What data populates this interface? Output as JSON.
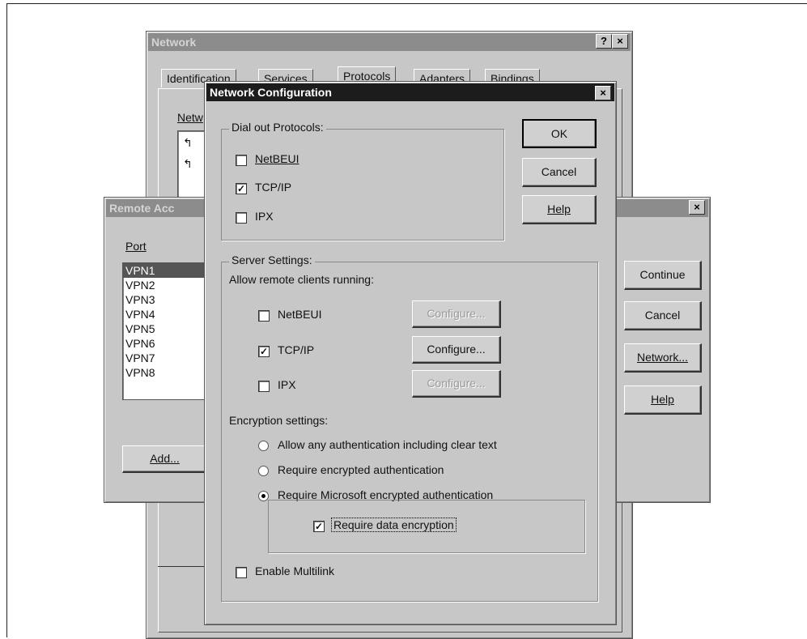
{
  "network_window": {
    "title": "Network",
    "help_btn": "?",
    "close_btn": "×",
    "tabs": [
      "Identification",
      "Services",
      "Protocols",
      "Adapters",
      "Bindings"
    ],
    "section_label": "Netw"
  },
  "remote_access_window": {
    "title": "Remote Acc",
    "close_btn": "×",
    "port_label": "Port",
    "ports": [
      "VPN1",
      "VPN2",
      "VPN3",
      "VPN4",
      "VPN5",
      "VPN6",
      "VPN7",
      "VPN8"
    ],
    "selected_port": "VPN1",
    "add_button": "Add...",
    "continue_button": "Continue",
    "cancel_button": "Cancel",
    "network_button": "Network...",
    "help_button": "Help"
  },
  "config_dialog": {
    "title": "Network Configuration",
    "close_btn": "×",
    "ok_button": "OK",
    "cancel_button": "Cancel",
    "help_button": "Help",
    "dial_out": {
      "label": "Dial out Protocols:",
      "netbeui": {
        "label": "NetBEUI",
        "checked": false
      },
      "tcpip": {
        "label": "TCP/IP",
        "checked": true
      },
      "ipx": {
        "label": "IPX",
        "checked": false
      }
    },
    "server": {
      "label": "Server Settings:",
      "allow_label": "Allow remote clients running:",
      "netbeui": {
        "label": "NetBEUI",
        "checked": false,
        "configure": "Configure..."
      },
      "tcpip": {
        "label": "TCP/IP",
        "checked": true,
        "configure": "Configure..."
      },
      "ipx": {
        "label": "IPX",
        "checked": false,
        "configure": "Configure..."
      },
      "encryption_label": "Encryption settings:",
      "enc_any": "Allow any authentication including clear text",
      "enc_encrypted": "Require encrypted authentication",
      "enc_microsoft": "Require Microsoft encrypted authentication",
      "selected_encryption": "enc_microsoft",
      "require_data_encryption": {
        "label": "Require data encryption",
        "checked": true
      },
      "multilink": {
        "label": "Enable Multilink",
        "checked": false
      }
    }
  }
}
